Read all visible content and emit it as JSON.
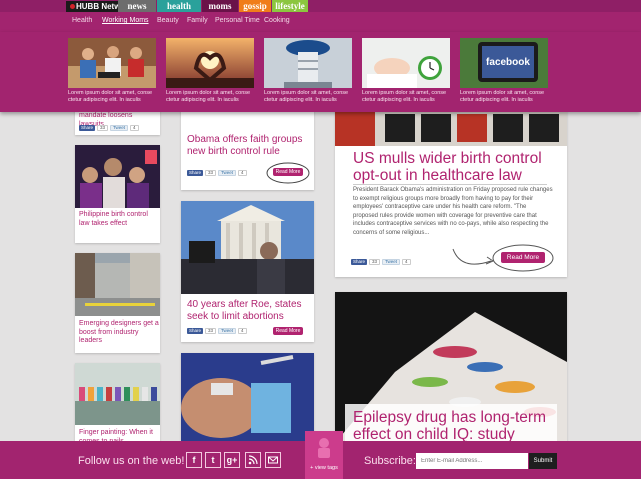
{
  "brand": {
    "network": "HUBB Network",
    "tabs": [
      {
        "label": "news",
        "color": "#6d6d6d"
      },
      {
        "label": "health",
        "color": "#2aa19b"
      },
      {
        "label": "moms",
        "color": "#8f1f66"
      },
      {
        "label": "gossip",
        "color": "#f07d1a"
      },
      {
        "label": "lifestyle",
        "color": "#8cc63f"
      }
    ]
  },
  "categories": [
    "Health",
    "Working Moms",
    "Beauty",
    "Family",
    "Personal Time",
    "Cooking"
  ],
  "featured": {
    "caption": "Lorem ipsum dolor sit amet, conse ctetur adipiscing elit. In iaculis",
    "facebook_label": "facebook"
  },
  "col1": {
    "top_title": "mandate loosens lawsuits",
    "cards": [
      {
        "title": "Philippine birth control law takes effect"
      },
      {
        "title": "Emerging designers get a boost from industry leaders"
      },
      {
        "title": "Finger painting: When it comes to nails"
      }
    ]
  },
  "col2": {
    "cards": [
      {
        "title": "Obama offers faith groups new birth control rule"
      },
      {
        "title": "40 years after Roe, states seek to limit abortions"
      }
    ]
  },
  "col3": {
    "lead": {
      "title": "US mulls wider birth control opt-out in healthcare law",
      "body": "President Barack Obama's administration on Friday proposed rule changes to exempt religious groups more broadly from having to pay for their employees' contraceptive care under his health care reform. \"The proposed rules provide women with coverage for preventive care that includes contraceptive services with no co-pays, while also respecting the concerns of some religious..."
    },
    "second": {
      "title": "Epilepsy drug has long-term effect on child IQ: study"
    }
  },
  "social": {
    "share": "Share",
    "share_count": "33",
    "tweet": "Tweet",
    "tweet_count": "4"
  },
  "read_more": "Read More",
  "footer": {
    "follow_text": "Follow us on the web!",
    "social_icons": [
      "facebook-icon",
      "twitter-icon",
      "google-plus-icon",
      "rss-icon",
      "email-icon"
    ],
    "view_tags": "+ view tags",
    "subscribe_label": "Subscribe:",
    "email_placeholder": "Enter E-mail Address...",
    "submit_label": "Submit"
  },
  "colors": {
    "brand_magenta": "#a2246f",
    "accent": "#b0236f",
    "background": "#e3e2e2"
  }
}
